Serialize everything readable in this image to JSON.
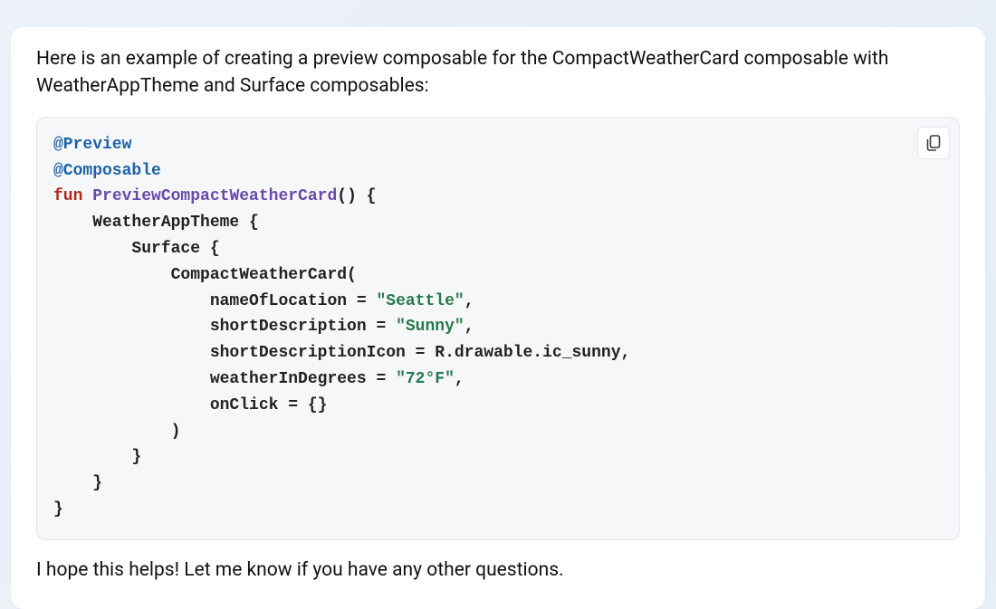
{
  "message": {
    "intro": "Here is an example of creating a preview composable for the CompactWeatherCard composable with WeatherAppTheme and Surface composables:",
    "outro": "I hope this helps! Let me know if you have any other questions."
  },
  "code": {
    "language": "kotlin",
    "tokens": {
      "ann_preview": "@Preview",
      "ann_composable": "@Composable",
      "kw_fun": "fun",
      "fn_name": "PreviewCompactWeatherCard",
      "l2_rest": "() {",
      "l3": "    WeatherAppTheme {",
      "l4": "        Surface {",
      "l5": "            CompactWeatherCard(",
      "l6a": "                nameOfLocation = ",
      "l6s": "\"Seattle\"",
      "l6b": ",",
      "l7a": "                shortDescription = ",
      "l7s": "\"Sunny\"",
      "l7b": ",",
      "l8": "                shortDescriptionIcon = R.drawable.ic_sunny,",
      "l9a": "                weatherInDegrees = ",
      "l9s": "\"72°F\"",
      "l9b": ",",
      "l10": "                onClick = {}",
      "l11": "            )",
      "l12": "        }",
      "l13": "    }",
      "l14": "}"
    }
  },
  "actions": {
    "copy_icon": "copy"
  }
}
